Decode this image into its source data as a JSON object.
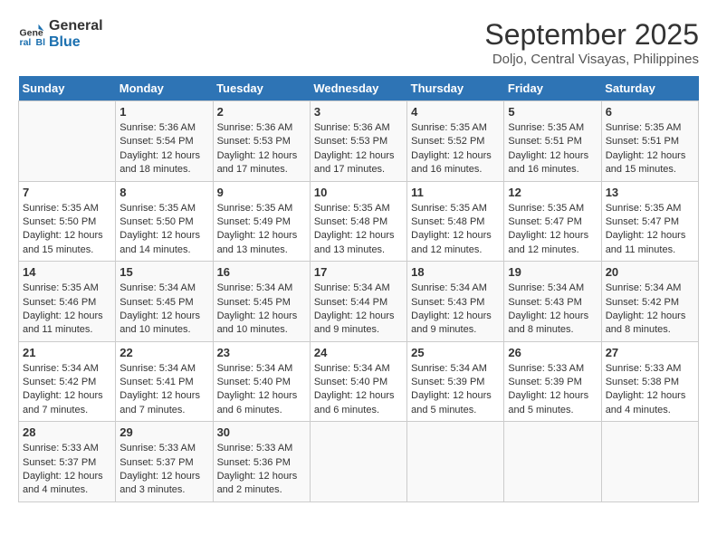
{
  "logo": {
    "line1": "General",
    "line2": "Blue"
  },
  "title": "September 2025",
  "subtitle": "Doljo, Central Visayas, Philippines",
  "weekdays": [
    "Sunday",
    "Monday",
    "Tuesday",
    "Wednesday",
    "Thursday",
    "Friday",
    "Saturday"
  ],
  "weeks": [
    [
      {
        "day": "",
        "content": ""
      },
      {
        "day": "1",
        "content": "Sunrise: 5:36 AM\nSunset: 5:54 PM\nDaylight: 12 hours\nand 18 minutes."
      },
      {
        "day": "2",
        "content": "Sunrise: 5:36 AM\nSunset: 5:53 PM\nDaylight: 12 hours\nand 17 minutes."
      },
      {
        "day": "3",
        "content": "Sunrise: 5:36 AM\nSunset: 5:53 PM\nDaylight: 12 hours\nand 17 minutes."
      },
      {
        "day": "4",
        "content": "Sunrise: 5:35 AM\nSunset: 5:52 PM\nDaylight: 12 hours\nand 16 minutes."
      },
      {
        "day": "5",
        "content": "Sunrise: 5:35 AM\nSunset: 5:51 PM\nDaylight: 12 hours\nand 16 minutes."
      },
      {
        "day": "6",
        "content": "Sunrise: 5:35 AM\nSunset: 5:51 PM\nDaylight: 12 hours\nand 15 minutes."
      }
    ],
    [
      {
        "day": "7",
        "content": "Sunrise: 5:35 AM\nSunset: 5:50 PM\nDaylight: 12 hours\nand 15 minutes."
      },
      {
        "day": "8",
        "content": "Sunrise: 5:35 AM\nSunset: 5:50 PM\nDaylight: 12 hours\nand 14 minutes."
      },
      {
        "day": "9",
        "content": "Sunrise: 5:35 AM\nSunset: 5:49 PM\nDaylight: 12 hours\nand 13 minutes."
      },
      {
        "day": "10",
        "content": "Sunrise: 5:35 AM\nSunset: 5:48 PM\nDaylight: 12 hours\nand 13 minutes."
      },
      {
        "day": "11",
        "content": "Sunrise: 5:35 AM\nSunset: 5:48 PM\nDaylight: 12 hours\nand 12 minutes."
      },
      {
        "day": "12",
        "content": "Sunrise: 5:35 AM\nSunset: 5:47 PM\nDaylight: 12 hours\nand 12 minutes."
      },
      {
        "day": "13",
        "content": "Sunrise: 5:35 AM\nSunset: 5:47 PM\nDaylight: 12 hours\nand 11 minutes."
      }
    ],
    [
      {
        "day": "14",
        "content": "Sunrise: 5:35 AM\nSunset: 5:46 PM\nDaylight: 12 hours\nand 11 minutes."
      },
      {
        "day": "15",
        "content": "Sunrise: 5:34 AM\nSunset: 5:45 PM\nDaylight: 12 hours\nand 10 minutes."
      },
      {
        "day": "16",
        "content": "Sunrise: 5:34 AM\nSunset: 5:45 PM\nDaylight: 12 hours\nand 10 minutes."
      },
      {
        "day": "17",
        "content": "Sunrise: 5:34 AM\nSunset: 5:44 PM\nDaylight: 12 hours\nand 9 minutes."
      },
      {
        "day": "18",
        "content": "Sunrise: 5:34 AM\nSunset: 5:43 PM\nDaylight: 12 hours\nand 9 minutes."
      },
      {
        "day": "19",
        "content": "Sunrise: 5:34 AM\nSunset: 5:43 PM\nDaylight: 12 hours\nand 8 minutes."
      },
      {
        "day": "20",
        "content": "Sunrise: 5:34 AM\nSunset: 5:42 PM\nDaylight: 12 hours\nand 8 minutes."
      }
    ],
    [
      {
        "day": "21",
        "content": "Sunrise: 5:34 AM\nSunset: 5:42 PM\nDaylight: 12 hours\nand 7 minutes."
      },
      {
        "day": "22",
        "content": "Sunrise: 5:34 AM\nSunset: 5:41 PM\nDaylight: 12 hours\nand 7 minutes."
      },
      {
        "day": "23",
        "content": "Sunrise: 5:34 AM\nSunset: 5:40 PM\nDaylight: 12 hours\nand 6 minutes."
      },
      {
        "day": "24",
        "content": "Sunrise: 5:34 AM\nSunset: 5:40 PM\nDaylight: 12 hours\nand 6 minutes."
      },
      {
        "day": "25",
        "content": "Sunrise: 5:34 AM\nSunset: 5:39 PM\nDaylight: 12 hours\nand 5 minutes."
      },
      {
        "day": "26",
        "content": "Sunrise: 5:33 AM\nSunset: 5:39 PM\nDaylight: 12 hours\nand 5 minutes."
      },
      {
        "day": "27",
        "content": "Sunrise: 5:33 AM\nSunset: 5:38 PM\nDaylight: 12 hours\nand 4 minutes."
      }
    ],
    [
      {
        "day": "28",
        "content": "Sunrise: 5:33 AM\nSunset: 5:37 PM\nDaylight: 12 hours\nand 4 minutes."
      },
      {
        "day": "29",
        "content": "Sunrise: 5:33 AM\nSunset: 5:37 PM\nDaylight: 12 hours\nand 3 minutes."
      },
      {
        "day": "30",
        "content": "Sunrise: 5:33 AM\nSunset: 5:36 PM\nDaylight: 12 hours\nand 2 minutes."
      },
      {
        "day": "",
        "content": ""
      },
      {
        "day": "",
        "content": ""
      },
      {
        "day": "",
        "content": ""
      },
      {
        "day": "",
        "content": ""
      }
    ]
  ]
}
